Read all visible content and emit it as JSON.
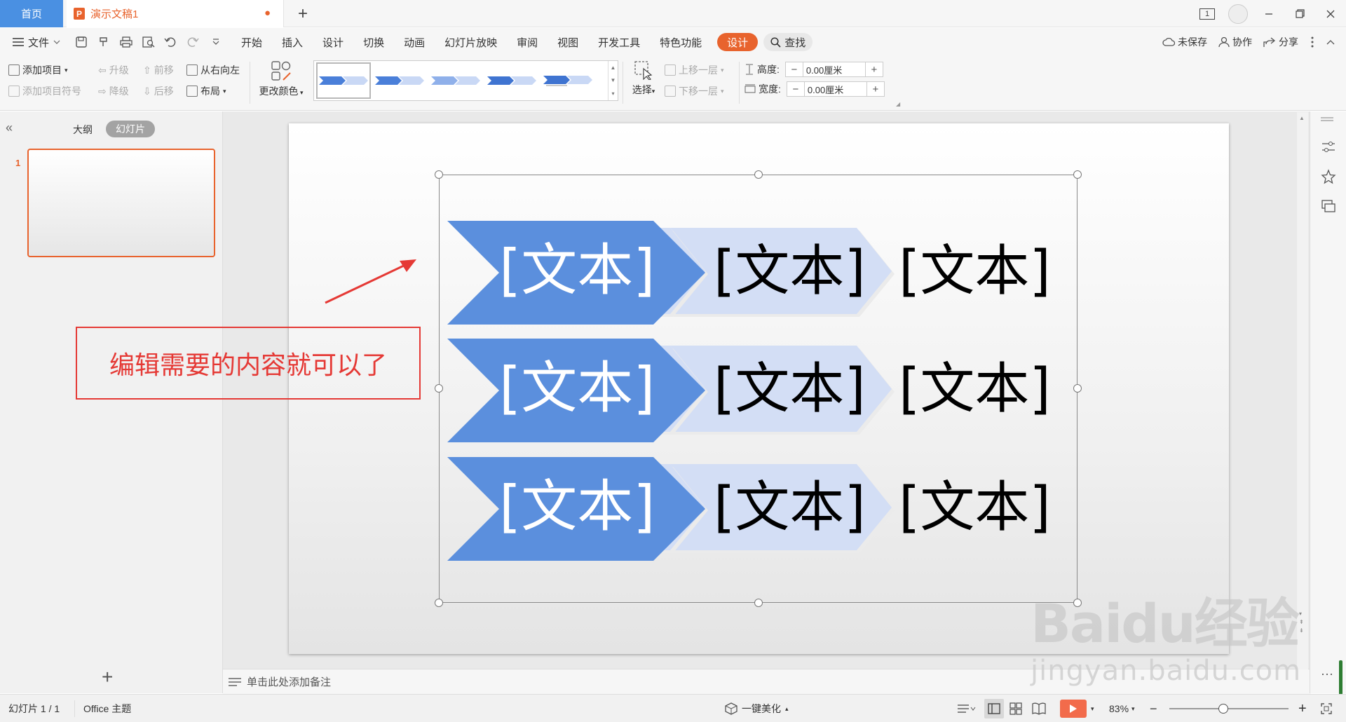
{
  "titlebar": {
    "home_tab": "首页",
    "doc_tab": "演示文稿1",
    "ppt_icon": "P",
    "unsaved_dot": "●",
    "add_tab": "+",
    "window_badge": "1"
  },
  "menubar": {
    "file": "文件",
    "tabs": [
      "开始",
      "插入",
      "设计",
      "切换",
      "动画",
      "幻灯片放映",
      "审阅",
      "视图",
      "开发工具",
      "特色功能"
    ],
    "active_context_tab": "设计",
    "search": "查找",
    "unsaved": "未保存",
    "collaborate": "协作",
    "share": "分享"
  },
  "ribbon": {
    "add_item": "添加项目",
    "add_bullet": "添加项目符号",
    "promote": "升级",
    "demote": "降级",
    "move_forward": "前移",
    "move_back": "后移",
    "right_to_left": "从右向左",
    "layout": "布局",
    "change_color": "更改颜色",
    "select": "选择",
    "bring_forward": "上移一层",
    "send_backward": "下移一层",
    "height_label": "高度:",
    "width_label": "宽度:",
    "height_value": "0.00厘米",
    "width_value": "0.00厘米",
    "minus": "−",
    "plus": "+"
  },
  "leftpanel": {
    "outline_tab": "大纲",
    "slides_tab": "幻灯片",
    "slide_number": "1",
    "add_slide": "+"
  },
  "slide": {
    "smartart_rows": [
      [
        "[文本]",
        "[文本]",
        "[文本]"
      ],
      [
        "[文本]",
        "[文本]",
        "[文本]"
      ],
      [
        "[文本]",
        "[文本]",
        "[文本]"
      ]
    ],
    "primary_color": "#5b8fdd",
    "secondary_color": "#d3def5"
  },
  "annotation": {
    "text": "编辑需要的内容就可以了",
    "color": "#e53935"
  },
  "notes": {
    "placeholder": "单击此处添加备注"
  },
  "statusbar": {
    "slide_counter": "幻灯片 1 / 1",
    "theme": "Office 主题",
    "beautify": "一键美化",
    "zoom": "83%",
    "zoom_fraction": 0.45
  },
  "watermark": {
    "brand": "Baidu经验",
    "url": "jingyan.baidu.com"
  }
}
